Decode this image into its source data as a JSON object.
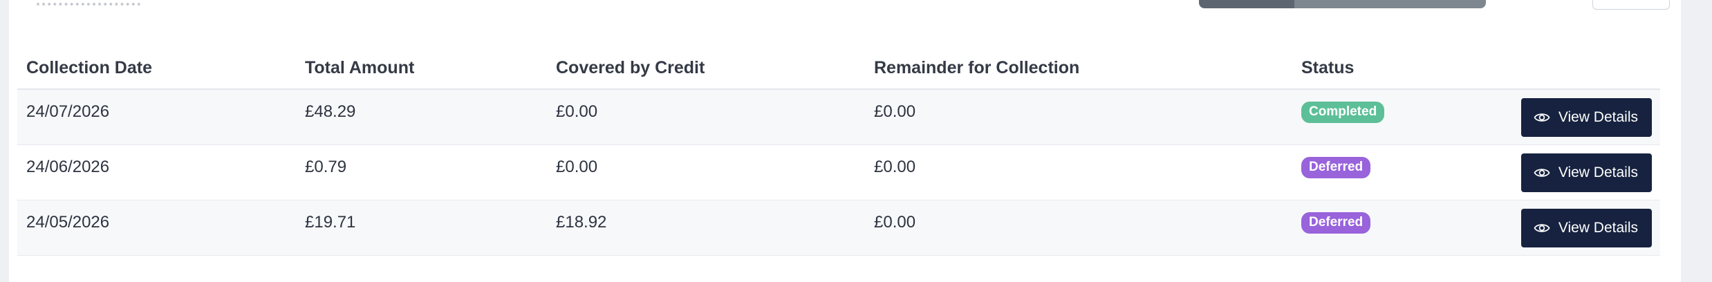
{
  "table": {
    "headers": {
      "collection_date": "Collection Date",
      "total_amount": "Total Amount",
      "covered_by_credit": "Covered by Credit",
      "remainder": "Remainder for Collection",
      "status": "Status"
    },
    "rows": [
      {
        "collection_date": "24/07/2026",
        "total_amount": "£48.29",
        "covered_by_credit": "£0.00",
        "remainder": "£0.00",
        "status": "Completed",
        "status_color": "#5cbf98",
        "action_label": "View Details"
      },
      {
        "collection_date": "24/06/2026",
        "total_amount": "£0.79",
        "covered_by_credit": "£0.00",
        "remainder": "£0.00",
        "status": "Deferred",
        "status_color": "#9863db",
        "action_label": "View Details"
      },
      {
        "collection_date": "24/05/2026",
        "total_amount": "£19.71",
        "covered_by_credit": "£18.92",
        "remainder": "£0.00",
        "status": "Deferred",
        "status_color": "#9863db",
        "action_label": "View Details"
      }
    ]
  },
  "colors": {
    "button_bg": "#16223f",
    "completed": "#5cbf98",
    "deferred": "#9863db"
  },
  "icons": {
    "view": "eye-icon"
  }
}
